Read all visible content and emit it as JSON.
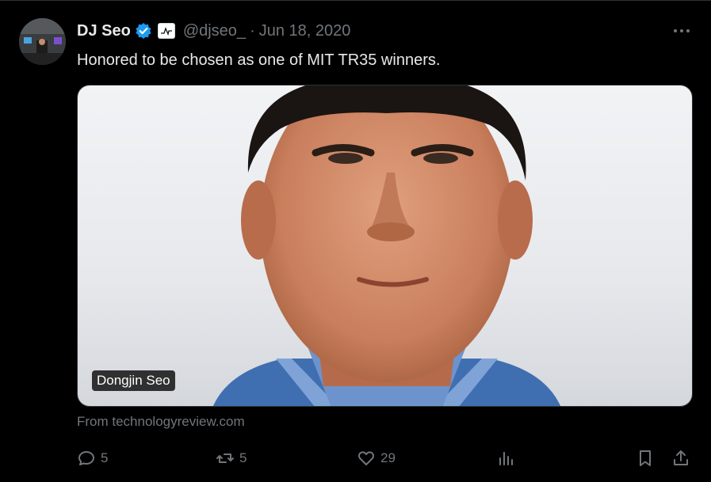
{
  "tweet": {
    "author": {
      "name": "DJ Seo",
      "handle": "@djseo_",
      "verified": true,
      "affiliation_badge": "neuralink-logo"
    },
    "separator": "·",
    "date": "Jun 18, 2020",
    "text": "Honored to be chosen as one of MIT TR35 winners.",
    "media": {
      "label": "Dongjin Seo",
      "source": "From technologyreview.com"
    },
    "actions": {
      "replies": "5",
      "retweets": "5",
      "likes": "29"
    },
    "colors": {
      "background": "#000000",
      "text_primary": "#e7e9ea",
      "text_secondary": "#71767b",
      "verified_blue": "#1d9bf0"
    }
  }
}
